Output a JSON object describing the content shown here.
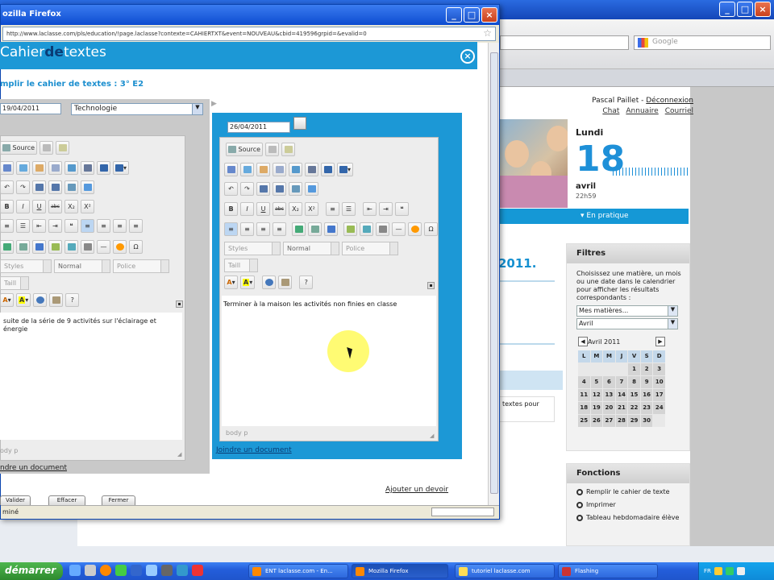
{
  "background_browser": {
    "search_placeholder": "Google",
    "user": {
      "name": "Pascal Paillet",
      "separator": "-",
      "logout": "Déconnexion",
      "links": [
        "Chat",
        "Annuaire",
        "Courriel"
      ]
    },
    "date_widget": {
      "day": "Lundi",
      "number": "18",
      "month": "avril",
      "time": "22h59"
    },
    "pratique_label": "En pratique",
    "page_title_fragment": "2011.",
    "page_text_fragment": "textes pour",
    "filters": {
      "title": "Filtres",
      "description": "Choisissez une matière, un mois ou une date dans le calendrier pour afficher les résultats correspondants :",
      "subject_select": "Mes matières...",
      "month_select": "Avril",
      "calendar": {
        "month_label": "Avril 2011",
        "prev": "◀",
        "next": "▶",
        "weekdays": [
          "L",
          "M",
          "M",
          "J",
          "V",
          "S",
          "D"
        ],
        "rows": [
          [
            "",
            "",
            "",
            "",
            "1",
            "2",
            "3"
          ],
          [
            "4",
            "5",
            "6",
            "7",
            "8",
            "9",
            "10"
          ],
          [
            "11",
            "12",
            "13",
            "14",
            "15",
            "16",
            "17"
          ],
          [
            "18",
            "19",
            "20",
            "21",
            "22",
            "23",
            "24"
          ],
          [
            "25",
            "26",
            "27",
            "28",
            "29",
            "30",
            ""
          ]
        ]
      }
    },
    "fonctions": {
      "title": "Fonctions",
      "items": [
        "Remplir le cahier de texte",
        "Imprimer",
        "Tableau hebdomadaire élève"
      ]
    }
  },
  "firefox_window": {
    "title": "ozilla Firefox",
    "url": "http://www.laclasse.com/pls/education/!page.laclasse?contexte=CAHIERTXT&event=NOUVEAU&cbid=419596grpid=&evalid=0",
    "status": "miné",
    "cahier": {
      "logo_part1": "Cahier",
      "logo_part2": "de",
      "logo_part3": "textes",
      "subtitle": "mplir le cahier de textes : 3° E2",
      "left": {
        "date": "19/04/2011",
        "subject": "Technologie",
        "content": "suite de la série de 9 activités sur l'éclairage et énergie",
        "body_path": "ody p",
        "attach": "ndre un document"
      },
      "right": {
        "date": "26/04/2011",
        "content": "Terminer à la maison les activités non finies en classe",
        "body_path": "body p",
        "attach": "Joindre un document"
      },
      "toolbar": {
        "source_label": "Source",
        "styles": "Styles",
        "format": "Normal",
        "font": "Police",
        "size": "Taill",
        "bold": "B",
        "italic": "I",
        "underline": "U",
        "strike": "abc",
        "sub": "X₂",
        "sup": "X²",
        "help": "?"
      },
      "add_homework": "Ajouter un devoir",
      "buttons": [
        "Valider",
        "Effacer",
        "Fermer"
      ]
    }
  },
  "taskbar": {
    "start": "démarrer",
    "items": [
      "ENT laclasse.com - En...",
      "Mozilla Firefox",
      "tutoriel laclasse.com",
      "Flashing"
    ],
    "tray_lang": "FR",
    "clock": ""
  }
}
